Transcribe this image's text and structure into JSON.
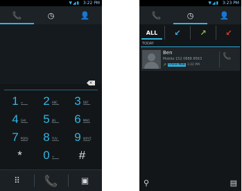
{
  "colors": {
    "accent": "#33b5e5",
    "background": "#131618",
    "outgoing": "#8bc34a",
    "missed": "#e53935"
  },
  "left": {
    "status": {
      "time": "3:22 PM",
      "icons": "▼◢▮"
    },
    "tabs": [
      {
        "icon": "phone-icon",
        "glyph": "📞"
      },
      {
        "icon": "clock-icon",
        "glyph": "◷"
      },
      {
        "icon": "contacts-icon",
        "glyph": "👤"
      }
    ],
    "delete_glyph": "×",
    "keys": [
      {
        "num": "1",
        "ltr": "∞"
      },
      {
        "num": "2",
        "ltr": "ABC"
      },
      {
        "num": "3",
        "ltr": "DEF"
      },
      {
        "num": "4",
        "ltr": "GHI"
      },
      {
        "num": "5",
        "ltr": "JKL"
      },
      {
        "num": "6",
        "ltr": "MNO"
      },
      {
        "num": "7",
        "ltr": "PQRS"
      },
      {
        "num": "8",
        "ltr": "TUV"
      },
      {
        "num": "9",
        "ltr": "WXYZ"
      },
      {
        "num": "*",
        "ltr": ""
      },
      {
        "num": "0",
        "ltr": "+"
      },
      {
        "num": "#",
        "ltr": ""
      }
    ],
    "bottom": {
      "menu_glyph": "⠿",
      "call_glyph": "📞",
      "contact_glyph": "▣"
    }
  },
  "right": {
    "status": {
      "time": "3:23 PM",
      "icons": "▼◢▮"
    },
    "tabs": [
      {
        "icon": "phone-icon",
        "glyph": "📞"
      },
      {
        "icon": "clock-icon",
        "glyph": "◷"
      },
      {
        "icon": "contacts-icon",
        "glyph": "👤"
      }
    ],
    "filters": [
      {
        "label": "ALL",
        "icon": "all"
      },
      {
        "label": "↙",
        "icon": "incoming-icon"
      },
      {
        "label": "↗",
        "icon": "outgoing-icon"
      },
      {
        "label": "↙",
        "icon": "missed-icon"
      }
    ],
    "section": "TODAY",
    "entry": {
      "name": "Ben",
      "number": "Mobile 152 0888 8563",
      "sim": "China Mob",
      "time": "3:22 PM"
    },
    "bottom": {
      "search_glyph": "⚲",
      "menu_glyph": "▤"
    }
  }
}
